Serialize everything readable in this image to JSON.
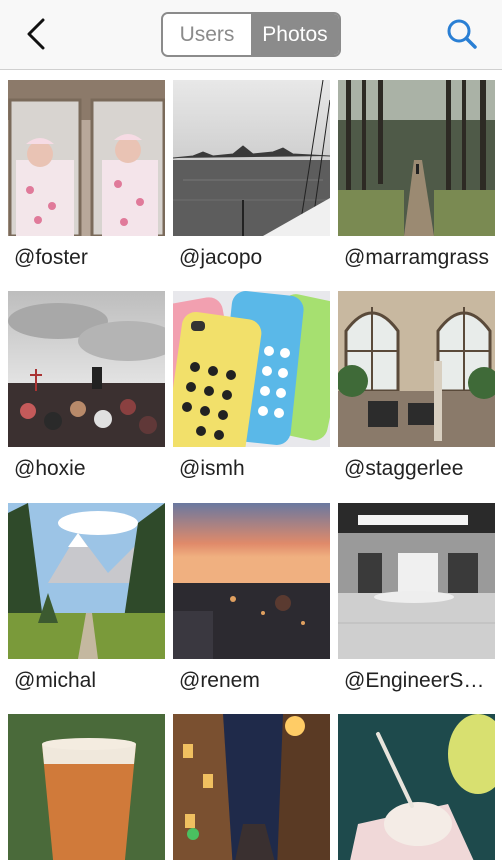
{
  "header": {
    "tabs": [
      {
        "label": "Users",
        "active": false
      },
      {
        "label": "Photos",
        "active": true
      }
    ],
    "back_icon": "chevron-left-icon",
    "search_icon": "search-icon",
    "accent_color": "#2a7fd4",
    "segment_color": "#8b8b8b"
  },
  "photos": [
    {
      "username": "@foster",
      "subject": "newborn babies in hospital bassinets"
    },
    {
      "username": "@jacopo",
      "subject": "black and white city skyline over water from a boat"
    },
    {
      "username": "@marramgrass",
      "subject": "forest path with tall trees"
    },
    {
      "username": "@hoxie",
      "subject": "crowd at an outdoor festival under cloudy sky"
    },
    {
      "username": "@ismh",
      "subject": "colorful perforated phone cases"
    },
    {
      "username": "@staggerlee",
      "subject": "conservatory with arched windows and plants"
    },
    {
      "username": "@michal",
      "subject": "alpine valley with pine trees and mountain"
    },
    {
      "username": "@renem",
      "subject": "city at sunset"
    },
    {
      "username": "@EngineerS…",
      "subject": "black and white empty hall"
    },
    {
      "username": "",
      "subject": "pint of beer"
    },
    {
      "username": "",
      "subject": "street at night with buildings"
    },
    {
      "username": "",
      "subject": "ice cream with spoon"
    }
  ]
}
